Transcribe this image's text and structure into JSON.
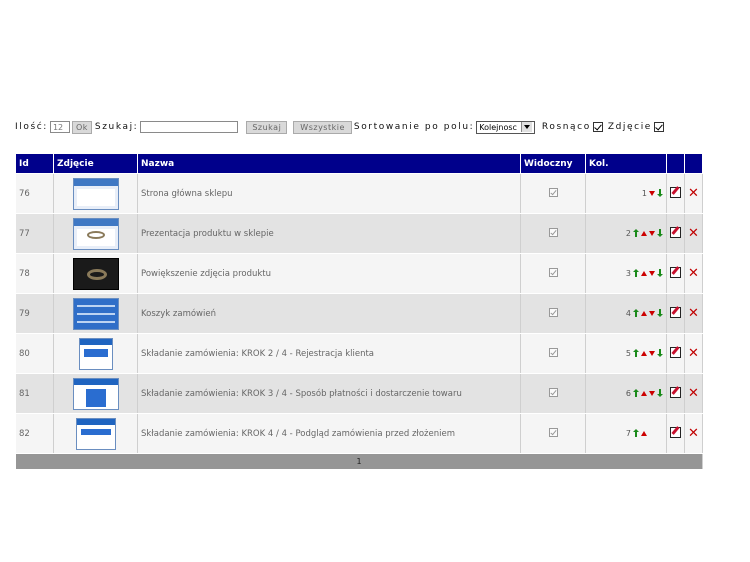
{
  "toolbar": {
    "ilosc_label": "Ilość:",
    "ilosc_value": "12",
    "ok_label": "Ok",
    "szukaj_label": "Szukaj:",
    "search_value": "",
    "search_button": "Szukaj",
    "all_button": "Wszystkie",
    "sort_label": "Sortowanie po polu:",
    "sort_selected": "Kolejnosc",
    "ascending_label": "Rosnąco",
    "ascending_checked": true,
    "photo_label": "Zdjęcie",
    "photo_checked": true
  },
  "table": {
    "headers": [
      "Id",
      "Zdjęcie",
      "Nazwa",
      "Widoczny",
      "Kol.",
      "",
      ""
    ],
    "rows": [
      {
        "id": "76",
        "thumb": "shop-home",
        "name": "Strona główna sklepu",
        "kol": "1",
        "visible": true
      },
      {
        "id": "77",
        "thumb": "product",
        "name": "Prezentacja produktu w sklepie",
        "kol": "2",
        "visible": true
      },
      {
        "id": "78",
        "thumb": "zoom",
        "name": "Powiększenie zdjęcia produktu",
        "kol": "3",
        "visible": true
      },
      {
        "id": "79",
        "thumb": "cart",
        "name": "Koszyk zamówień",
        "kol": "4",
        "visible": true
      },
      {
        "id": "80",
        "thumb": "step2",
        "name": "Składanie zamówienia: KROK 2 / 4 - Rejestracja klienta",
        "kol": "5",
        "visible": true
      },
      {
        "id": "81",
        "thumb": "step3",
        "name": "Składanie zamówienia: KROK 3 / 4 - Sposób płatności i dostarczenie towaru",
        "kol": "6",
        "visible": true
      },
      {
        "id": "82",
        "thumb": "step4",
        "name": "Składanie zamówienia: KROK 4 / 4 - Podgląd zamówienia przed złożeniem",
        "kol": "7",
        "visible": true
      }
    ],
    "pagination": "1"
  },
  "colors": {
    "header_bg": "#00008b",
    "row_odd": "#f5f5f5",
    "row_even": "#e3e3e3",
    "footer_bg": "#969696",
    "delete_red": "#c00000",
    "arrow_red": "#cc0000",
    "arrow_green": "#1a8a1a"
  },
  "icons": {
    "edit": "edit-icon",
    "delete": "delete-icon",
    "move_top": "move-top-icon",
    "move_up": "move-up-icon",
    "move_down": "move-down-icon",
    "move_bottom": "move-bottom-icon"
  }
}
